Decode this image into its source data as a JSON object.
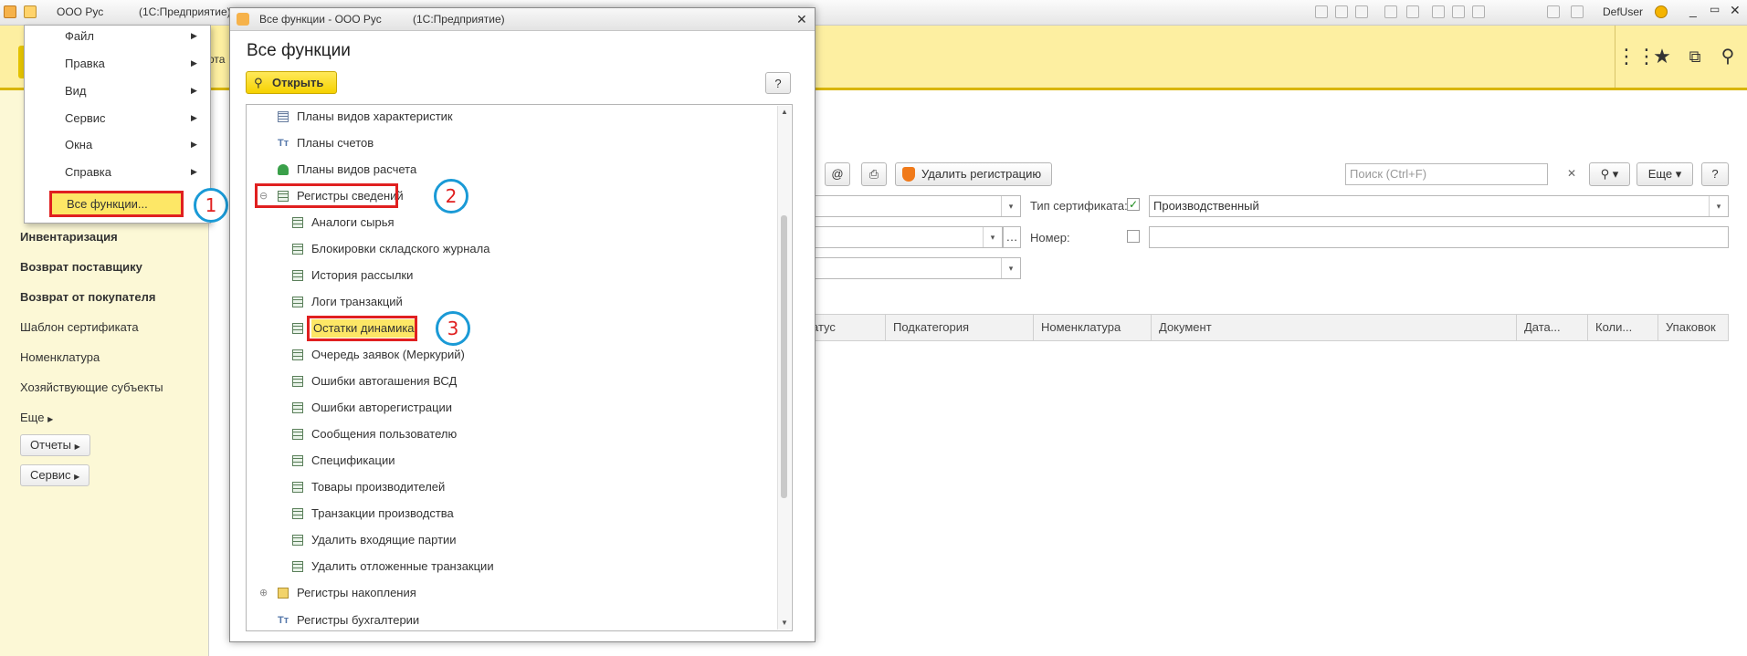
{
  "titlebar": {
    "app_name": "ООО Рус",
    "platform": "(1С:Предприятие)",
    "user": "DefUser"
  },
  "main_menu": {
    "items": [
      "Файл",
      "Правка",
      "Вид",
      "Сервис",
      "Окна",
      "Справка"
    ],
    "all_functions": "Все функции..."
  },
  "sidebar": {
    "partial_text": "ота",
    "bold_items": [
      "Инвентаризация",
      "Возврат поставщику",
      "Возврат от покупателя"
    ],
    "items": [
      "Шаблон сертификата",
      "Номенклатура",
      "Хозяйствующие субъекты"
    ],
    "more": "Еще",
    "buttons": [
      "Отчеты",
      "Сервис"
    ]
  },
  "form": {
    "delete_registration": "Удалить регистрацию",
    "search_placeholder": "Поиск (Ctrl+F)",
    "more_button": "Еще",
    "help": "?",
    "cert_type_label": "Тип сертификата:",
    "cert_type_value": "Производственный",
    "number_label": "Номер:",
    "columns": [
      "атус",
      "Подкатегория",
      "Номенклатура",
      "Документ",
      "Дата...",
      "Коли...",
      "Упаковок"
    ]
  },
  "dialog": {
    "title_app": "Все функции - ООО Рус",
    "title_platform": "(1С:Предприятие)",
    "heading": "Все функции",
    "open_button": "Открыть",
    "help": "?",
    "tree_top": [
      "Планы видов характеристик",
      "Планы счетов",
      "Планы видов расчета"
    ],
    "registers_info": "Регистры сведений",
    "registers_children": [
      "Аналоги сырья",
      "Блокировки складского журнала",
      "История рассылки",
      "Логи транзакций",
      "Остатки динамика",
      "Очередь заявок (Меркурий)",
      "Ошибки автогашения ВСД",
      "Ошибки авторегистрации",
      "Сообщения пользователю",
      "Спецификации",
      "Товары производителей",
      "Транзакции производства",
      "Удалить входящие партии",
      "Удалить отложенные транзакции"
    ],
    "tree_bottom": [
      "Регистры накопления",
      "Регистры бухгалтерии"
    ]
  },
  "annotations": [
    "1",
    "2",
    "3"
  ],
  "colors": {
    "accent_yellow": "#fdefa1",
    "highlight_red": "#e02020",
    "callout_blue": "#1a9ad6"
  }
}
